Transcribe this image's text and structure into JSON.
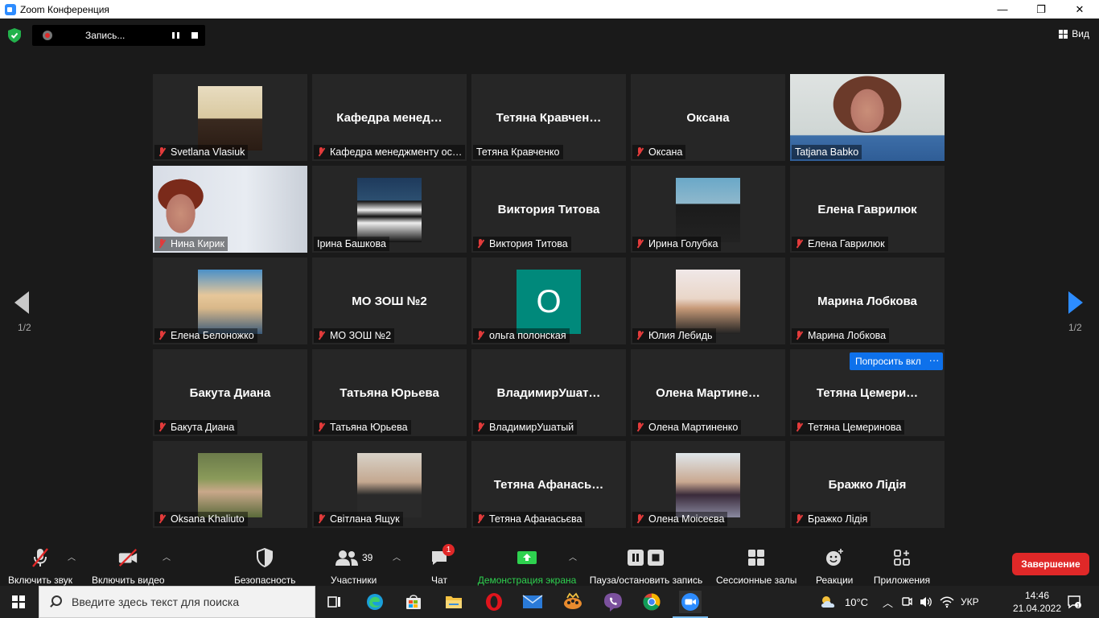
{
  "window": {
    "title": "Zoom Конференция",
    "minimize": "—",
    "maximize": "❐",
    "close": "✕"
  },
  "topbar": {
    "recording_label": "Запись...",
    "view_label": "Вид"
  },
  "pagination": {
    "left_indicator": "1/2",
    "right_indicator": "1/2"
  },
  "tiles": [
    {
      "display": "Svetlana Vlasiuk",
      "label": "Svetlana Vlasiuk",
      "kind": "photo",
      "muted": true
    },
    {
      "display": "Кафедра менед…",
      "label": "Кафедра менеджменту ос…",
      "kind": "name",
      "muted": true
    },
    {
      "display": "Тетяна Кравчен…",
      "label": "Тетяна Кравченко",
      "kind": "name",
      "muted": false
    },
    {
      "display": "Оксана",
      "label": "Оксана",
      "kind": "name",
      "muted": true
    },
    {
      "display": "Tatjana Babko",
      "label": "Tatjana Babko",
      "kind": "video",
      "muted": false,
      "active": true
    },
    {
      "display": "Нина Кирик",
      "label": "Нина Кирик",
      "kind": "video",
      "muted": true
    },
    {
      "display": "Ірина Башкова",
      "label": "Ірина Башкова",
      "kind": "photo",
      "muted": false
    },
    {
      "display": "Виктория Титова",
      "label": "Виктория Титова",
      "kind": "name",
      "muted": true
    },
    {
      "display": "Ирина Голубка",
      "label": "Ирина Голубка",
      "kind": "photo",
      "muted": true
    },
    {
      "display": "Елена Гаврилюк",
      "label": "Елена Гаврилюк",
      "kind": "name",
      "muted": true
    },
    {
      "display": "Елена Белоножко",
      "label": "Елена Белоножко",
      "kind": "photo",
      "muted": true
    },
    {
      "display": "МО ЗОШ №2",
      "label": "МО ЗОШ №2",
      "kind": "name",
      "muted": true
    },
    {
      "display": "ольга полонская",
      "label": "ольга полонская",
      "kind": "letter",
      "letter": "О",
      "muted": true
    },
    {
      "display": "Юлия Лебидь",
      "label": "Юлия Лебидь",
      "kind": "photo",
      "muted": true
    },
    {
      "display": "Марина Лобкова",
      "label": "Марина Лобкова",
      "kind": "name",
      "muted": true
    },
    {
      "display": "Бакута Диана",
      "label": "Бакута Диана",
      "kind": "name",
      "muted": true
    },
    {
      "display": "Татьяна Юрьева",
      "label": "Татьяна Юрьева",
      "kind": "name",
      "muted": true
    },
    {
      "display": "ВладимирУшат…",
      "label": "ВладимирУшатый",
      "kind": "name",
      "muted": true
    },
    {
      "display": "Олена  Мартине…",
      "label": "Олена Мартиненко",
      "kind": "name",
      "muted": true
    },
    {
      "display": "Тетяна  Цемери…",
      "label": "Тетяна Цемеринова",
      "kind": "name",
      "muted": true
    },
    {
      "display": "Oksana Khaliuto",
      "label": "Oksana Khaliuto",
      "kind": "photo",
      "muted": true
    },
    {
      "display": "Світлана Ящук",
      "label": "Світлана Ящук",
      "kind": "photo",
      "muted": true
    },
    {
      "display": "Тетяна  Афанась…",
      "label": "Тетяна Афанасьєва",
      "kind": "name",
      "muted": true
    },
    {
      "display": "Олена Моісеєва",
      "label": "Олена Моісеєва",
      "kind": "photo",
      "muted": true
    },
    {
      "display": "Бражко Лідія",
      "label": "Бражко Лідія",
      "kind": "name",
      "muted": true
    }
  ],
  "tile_actions": {
    "ask_unmute": "Попросить вкл",
    "more": "···"
  },
  "toolbar": {
    "unmute": "Включить звук",
    "start_video": "Включить видео",
    "security": "Безопасность",
    "participants": "Участники",
    "participants_count": "39",
    "chat": "Чат",
    "chat_badge": "1",
    "share": "Демонстрация экрана",
    "pause_recording": "Пауза/остановить запись",
    "breakout": "Сессионные залы",
    "reactions": "Реакции",
    "apps": "Приложения",
    "end": "Завершение"
  },
  "taskbar": {
    "search_placeholder": "Введите здесь текст для поиска",
    "weather": "10°C",
    "language": "УКР",
    "time": "14:46",
    "date": "21.04.2022"
  },
  "colors": {
    "accent": "#0e71eb",
    "end": "#e02828",
    "share_green": "#2ed14f",
    "active_border": "#c8e04a"
  }
}
